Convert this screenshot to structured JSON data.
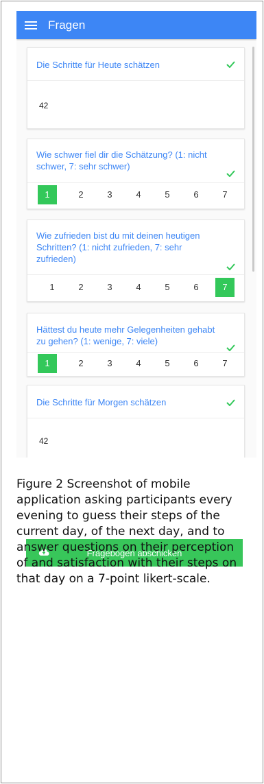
{
  "app": {
    "title": "Fragen"
  },
  "cards": [
    {
      "question": "Die Schritte für Heute schätzen",
      "answer": "42"
    },
    {
      "question": "Wie schwer fiel dir die Schätzung? (1: nicht schwer, 7: sehr schwer)",
      "options": [
        "1",
        "2",
        "3",
        "4",
        "5",
        "6",
        "7"
      ],
      "selected": 1
    },
    {
      "question": "Wie zufrieden bist du mit deinen heutigen Schritten? (1: nicht zufrieden, 7: sehr zufrieden)",
      "options": [
        "1",
        "2",
        "3",
        "4",
        "5",
        "6",
        "7"
      ],
      "selected": 7
    },
    {
      "question": "Hättest du heute mehr Gelegenheiten gehabt zu gehen? (1: wenige, 7: viele)",
      "options": [
        "1",
        "2",
        "3",
        "4",
        "5",
        "6",
        "7"
      ],
      "selected": 1
    },
    {
      "question": "Die Schritte für Morgen schätzen",
      "answer": "42"
    }
  ],
  "submit": {
    "label": "Fragebogen abschicken",
    "icon": "cloud-upload-icon"
  },
  "caption": "Figure 2 Screenshot of mobile application asking participants every evening to guess their steps of the current day, of the next day, and to answer questions on their perception of and satisfaction with their steps on that day on a 7-point likert-scale.",
  "colors": {
    "app_bar": "#3d86f5",
    "question_text": "#3d86f5",
    "selected_option": "#33c85a",
    "submit_button": "#38c65a",
    "check": "#33c85a"
  }
}
